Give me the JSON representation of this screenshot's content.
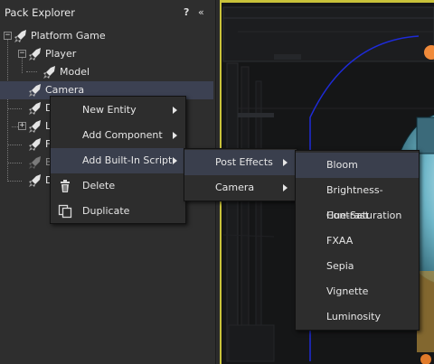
{
  "panel": {
    "title": "Pack Explorer",
    "help_label": "?",
    "collapse_label": "«"
  },
  "tree": {
    "items": [
      {
        "label": "Platform Game"
      },
      {
        "label": "Player"
      },
      {
        "label": "Model"
      },
      {
        "label": "Camera"
      },
      {
        "label": "D"
      },
      {
        "label": "L"
      },
      {
        "label": "F"
      },
      {
        "label": "B"
      },
      {
        "label": "D"
      }
    ],
    "expander_collapsed": "+",
    "expander_expanded": "−"
  },
  "context_menu": {
    "items": [
      {
        "label": "New Entity"
      },
      {
        "label": "Add Component"
      },
      {
        "label": "Add Built-In Script"
      },
      {
        "label": "Delete",
        "icon": "trash-icon"
      },
      {
        "label": "Duplicate",
        "icon": "duplicate-icon"
      }
    ]
  },
  "submenu": {
    "items": [
      {
        "label": "Post Effects"
      },
      {
        "label": "Camera"
      }
    ]
  },
  "post_effects_menu": {
    "items": [
      {
        "label": "Bloom"
      },
      {
        "label": "Brightness-Contrast"
      },
      {
        "label": "Hue-Saturation"
      },
      {
        "label": "FXAA"
      },
      {
        "label": "Sepia"
      },
      {
        "label": "Vignette"
      },
      {
        "label": "Luminosity"
      }
    ]
  },
  "colors": {
    "accent_yellow": "#c9c23a",
    "selection": "#3c4152",
    "menu_highlight": "#3a3f4d",
    "camera_gizmo": "#1e2bd8"
  }
}
